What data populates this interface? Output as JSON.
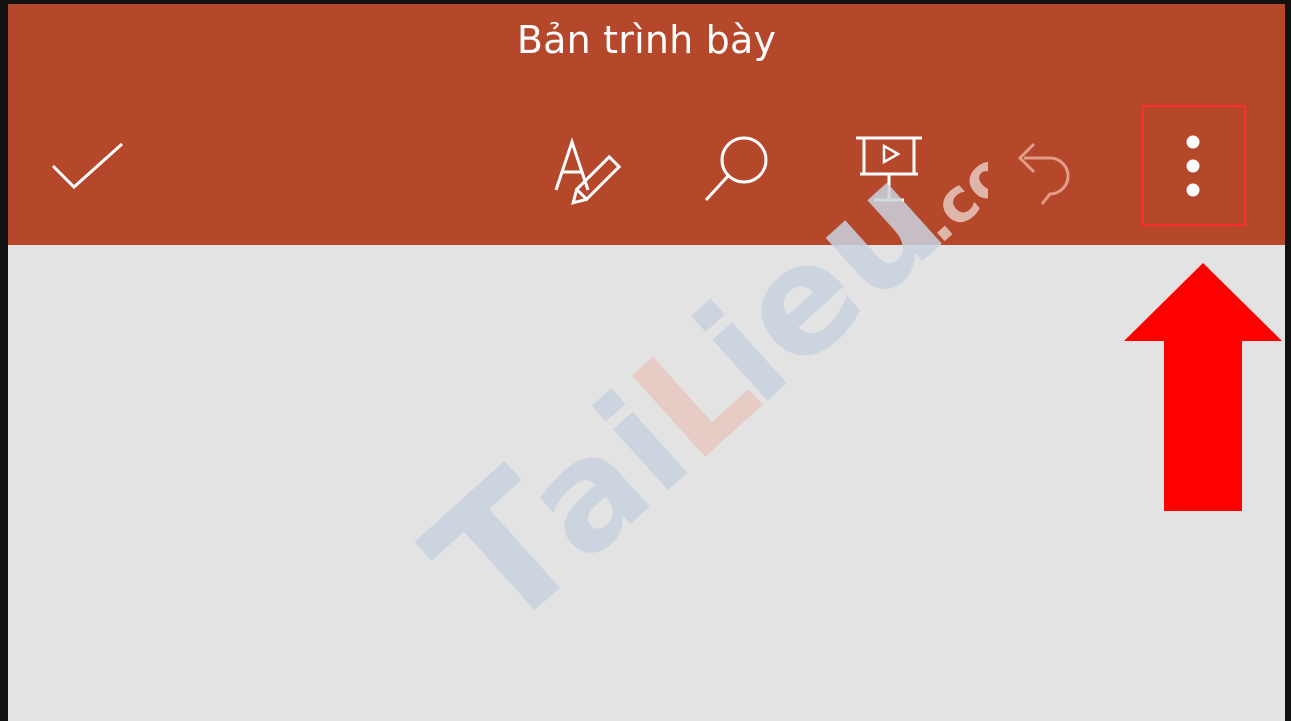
{
  "app": {
    "title": "Bản trình bày"
  },
  "toolbar": {
    "buttons": [
      {
        "name": "confirm",
        "icon": "checkmark-icon"
      },
      {
        "name": "draw",
        "icon": "draw-pen-icon"
      },
      {
        "name": "search",
        "icon": "search-icon"
      },
      {
        "name": "present",
        "icon": "present-slideshow-icon"
      },
      {
        "name": "undo",
        "icon": "undo-icon"
      },
      {
        "name": "more-options",
        "icon": "more-vertical-icon"
      }
    ]
  },
  "annotation": {
    "highlight_color": "#ff2d2d",
    "arrow_color": "#ff0000",
    "arrow_direction": "up"
  },
  "watermark": {
    "text": "TaiLieu.com"
  },
  "colors": {
    "header": "#b5472b",
    "content": "#e3e3e3",
    "icon": "#ffffff"
  }
}
